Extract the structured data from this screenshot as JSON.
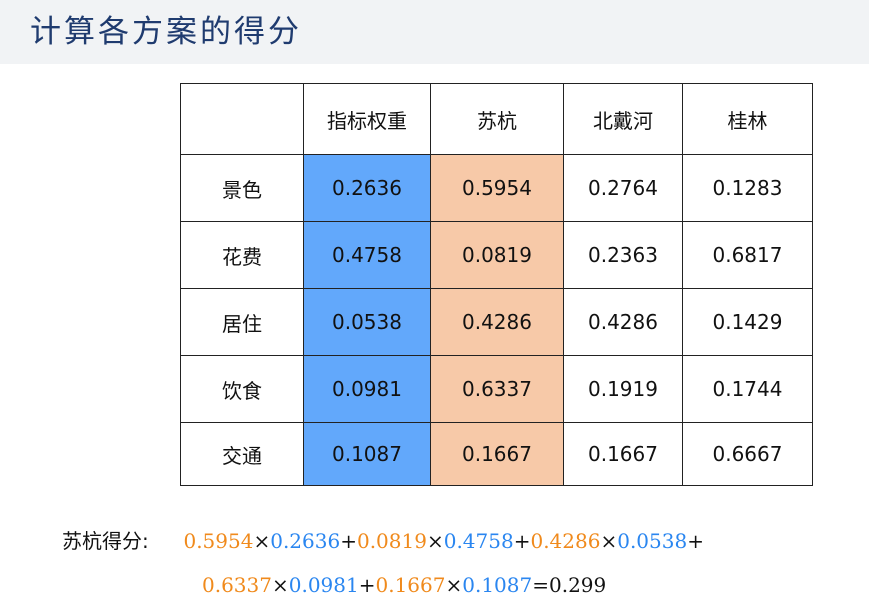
{
  "title": "计算各方案的得分",
  "colors": {
    "weight_fill": "#62a8fb",
    "suhang_fill": "#f7c9a8",
    "orange_text": "#f08a1c",
    "blue_text": "#2a86f0",
    "title_color": "#1f3b6f"
  },
  "table": {
    "headers": [
      "",
      "指标权重",
      "苏杭",
      "北戴河",
      "桂林"
    ],
    "rows": [
      [
        "景色",
        "0.2636",
        "0.5954",
        "0.2764",
        "0.1283"
      ],
      [
        "花费",
        "0.4758",
        "0.0819",
        "0.2363",
        "0.6817"
      ],
      [
        "居住",
        "0.0538",
        "0.4286",
        "0.4286",
        "0.1429"
      ],
      [
        "饮食",
        "0.0981",
        "0.6337",
        "0.1919",
        "0.1744"
      ],
      [
        "交通",
        "0.1087",
        "0.1667",
        "0.1667",
        "0.6667"
      ]
    ]
  },
  "formula": {
    "label": "苏杭得分:",
    "terms": [
      {
        "a": "0.5954",
        "b": "0.2636"
      },
      {
        "a": "0.0819",
        "b": "0.4758"
      },
      {
        "a": "0.4286",
        "b": "0.0538"
      },
      {
        "a": "0.6337",
        "b": "0.0981"
      },
      {
        "a": "0.1667",
        "b": "0.1087"
      }
    ],
    "times": "×",
    "plus": "+",
    "equals": "=",
    "result": "0.299"
  }
}
